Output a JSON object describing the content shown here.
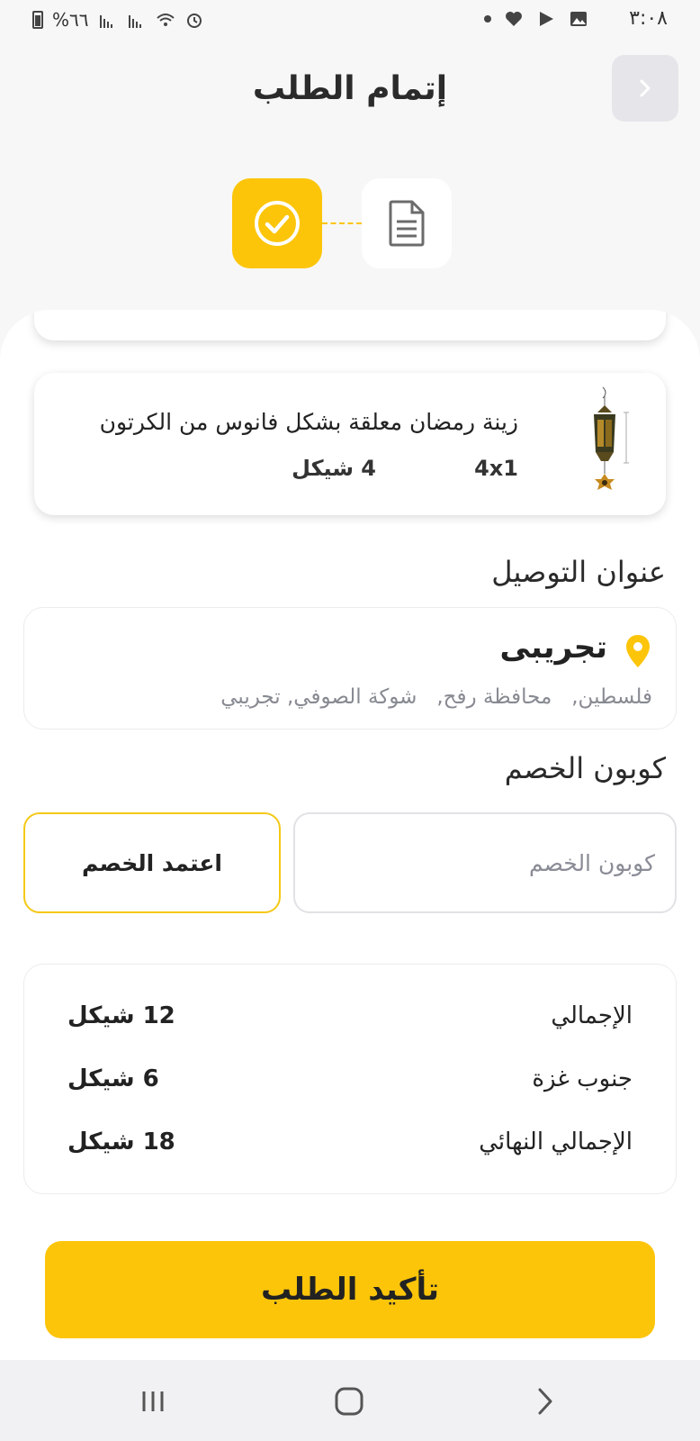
{
  "status_bar": {
    "time": "٣:٠٨",
    "battery": "%٦٦"
  },
  "header": {
    "title": "إتمام الطلب"
  },
  "steps": {
    "done_icon": "check-circle-icon",
    "next_icon": "document-icon"
  },
  "product": {
    "name": "زينة رمضان معلقة بشكل فانوس من الكرتون",
    "quantity": "4x1",
    "price": "4 شيكل"
  },
  "address": {
    "section_title": "عنوان التوصيل",
    "name": "تجريبى",
    "line": "فلسطين,   محافظة رفح,   شوكة الصوفي, تجريبي"
  },
  "coupon": {
    "section_title": "كوبون الخصم",
    "placeholder": "كوبون الخصم",
    "value": "",
    "apply_label": "اعتمد الخصم"
  },
  "summary": {
    "rows": [
      {
        "label": "الإجمالي",
        "value": "12 شيكل"
      },
      {
        "label": "جنوب غزة",
        "value": "6 شيكل"
      },
      {
        "label": "الإجمالي النهائي",
        "value": "18 شيكل"
      }
    ]
  },
  "confirm": {
    "label": "تأكيد الطلب"
  },
  "colors": {
    "accent": "#fcc50a",
    "muted_text": "#888a92"
  }
}
